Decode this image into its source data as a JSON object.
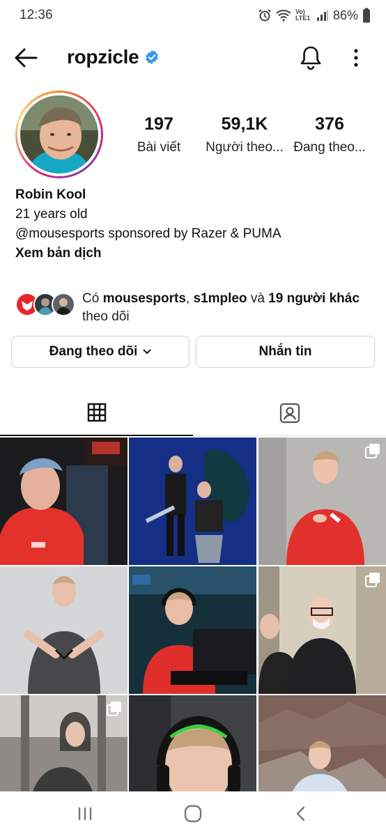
{
  "status_bar": {
    "time": "12:36",
    "network": "Vo) LTE1",
    "battery": "86%"
  },
  "header": {
    "username": "ropzicle",
    "verified": true
  },
  "profile": {
    "stats": [
      {
        "value": "197",
        "label": "Bài viết"
      },
      {
        "value": "59,1K",
        "label": "Người theo..."
      },
      {
        "value": "376",
        "label": "Đang theo..."
      }
    ],
    "name": "Robin Kool",
    "bio_line1": "21 years old",
    "bio_line2": "@mousesports sponsored by Razer & PUMA",
    "translate": "Xem bản dịch"
  },
  "followed_by": {
    "prefix": "Có ",
    "account1": "mousesports",
    "sep": ", ",
    "account2": "s1mpleo",
    "and": " và ",
    "others": "19 người khác",
    "suffix": "theo dõi"
  },
  "actions": {
    "following": "Đang theo dõi",
    "message": "Nhắn tin"
  },
  "tabs": [
    {
      "icon": "grid-icon"
    },
    {
      "icon": "tagged-icon"
    }
  ],
  "colors": {
    "verified": "#3897f0",
    "mouz_red": "#e5262b",
    "text": "#111111"
  },
  "grid_posts": [
    {
      "name": "post-1",
      "multi": false
    },
    {
      "name": "post-2",
      "multi": false
    },
    {
      "name": "post-3",
      "multi": true
    },
    {
      "name": "post-4",
      "multi": false
    },
    {
      "name": "post-5",
      "multi": false
    },
    {
      "name": "post-6",
      "multi": true
    },
    {
      "name": "post-7",
      "multi": true
    },
    {
      "name": "post-8",
      "multi": false
    },
    {
      "name": "post-9",
      "multi": false
    }
  ]
}
